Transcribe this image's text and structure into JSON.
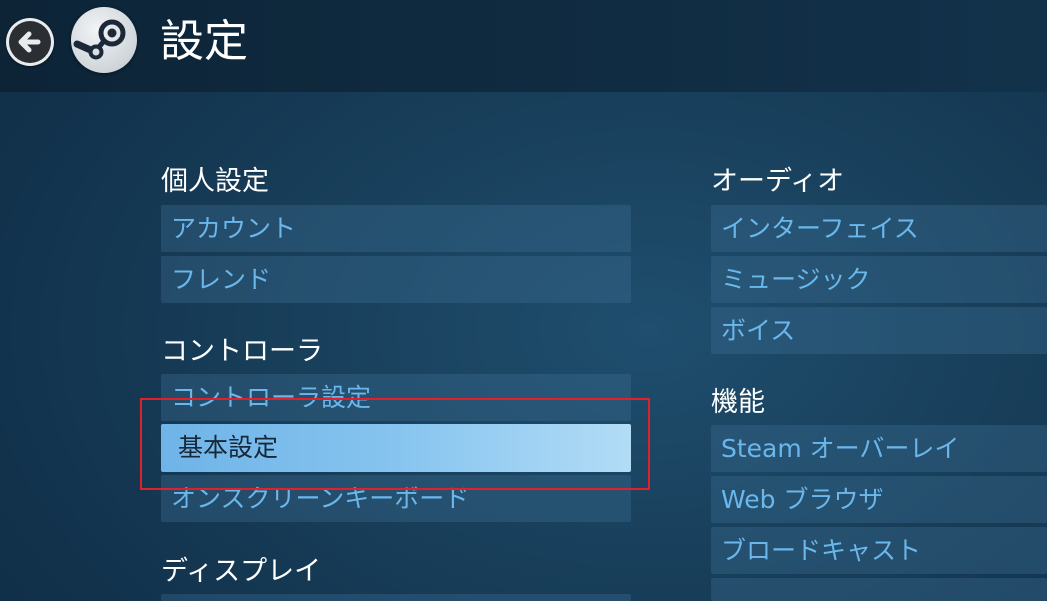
{
  "header": {
    "title": "設定",
    "back_icon": "back-arrow-icon",
    "logo_icon": "steam-logo-icon"
  },
  "left": {
    "sections": [
      {
        "title": "個人設定",
        "items": [
          "アカウント",
          "フレンド"
        ]
      },
      {
        "title": "コントローラ",
        "items": [
          "コントローラ設定",
          "基本設定",
          "オンスクリーンキーボード"
        ]
      },
      {
        "title": "ディスプレイ",
        "items": []
      }
    ]
  },
  "right": {
    "sections": [
      {
        "title": "オーディオ",
        "items": [
          "インターフェイス",
          "ミュージック",
          "ボイス"
        ]
      },
      {
        "title": "機能",
        "items": [
          "Steam オーバーレイ",
          "Web ブラウザ",
          "ブロードキャスト"
        ]
      }
    ]
  },
  "selected_item": "基本設定",
  "colors": {
    "accent": "#6ab7ec",
    "highlight_outline": "#e0212b",
    "background": "#173d58"
  }
}
